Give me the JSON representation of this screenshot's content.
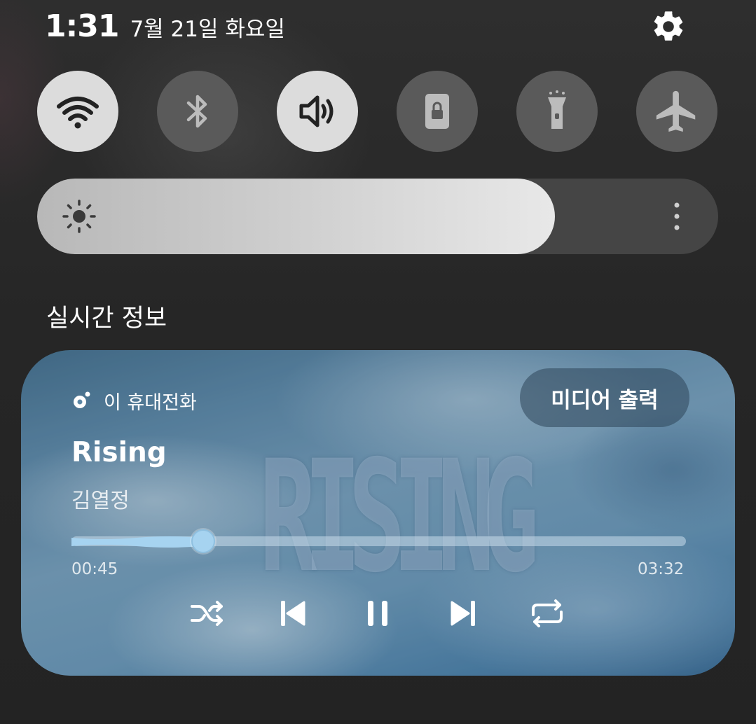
{
  "status_bar": {
    "time": "1:31",
    "date": "7월 21일 화요일",
    "settings_icon": "gear-icon"
  },
  "quick_settings": [
    {
      "id": "wifi",
      "icon": "wifi-icon",
      "active": true
    },
    {
      "id": "bluetooth",
      "icon": "bluetooth-icon",
      "active": false
    },
    {
      "id": "sound",
      "icon": "volume-icon",
      "active": true
    },
    {
      "id": "rotation-lock",
      "icon": "portrait-lock-icon",
      "active": false
    },
    {
      "id": "flashlight",
      "icon": "flashlight-icon",
      "active": false
    },
    {
      "id": "airplane",
      "icon": "airplane-icon",
      "active": false
    }
  ],
  "brightness": {
    "level": 0.76,
    "icon": "sun-icon",
    "more_icon": "more-vertical-icon"
  },
  "section": {
    "title": "실시간 정보"
  },
  "media": {
    "device_label": "이 휴대전화",
    "output_button": "미디어 출력",
    "song_title": "Rising",
    "artist": "김열정",
    "album_art_text": "RISING",
    "current_time": "00:45",
    "total_time": "03:32",
    "progress": 0.212,
    "controls": [
      "shuffle-icon",
      "previous-icon",
      "pause-icon",
      "next-icon",
      "repeat-icon"
    ]
  },
  "colors": {
    "background": "#262626",
    "toggle_on": "#dcdcdc",
    "toggle_off": "#5a5a5a",
    "progress_accent": "#a6d3f0"
  }
}
